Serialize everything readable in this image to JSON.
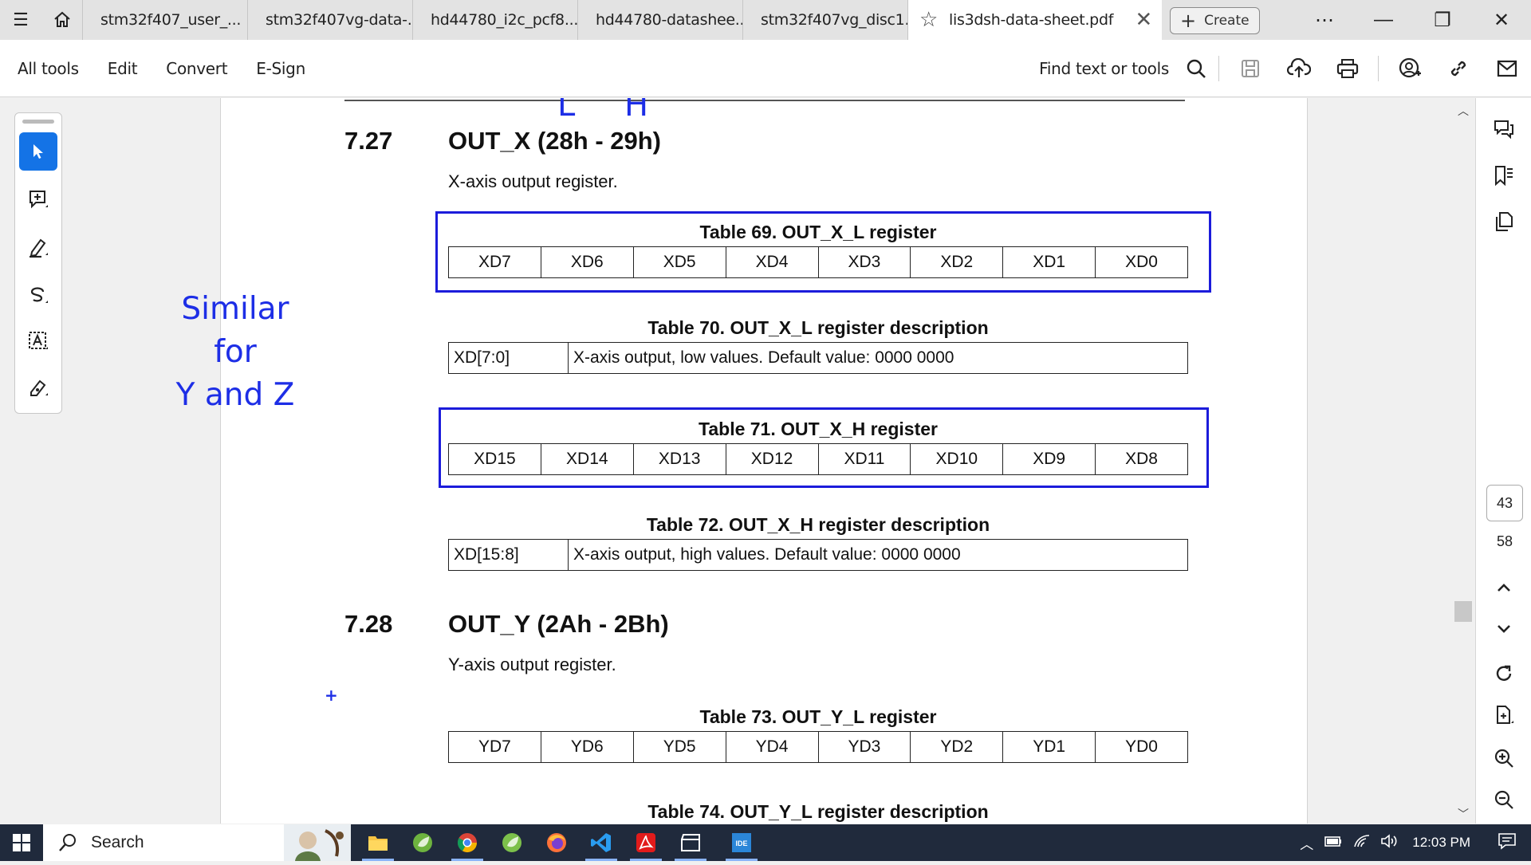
{
  "tabs": [
    {
      "label": "stm32f407_user_..."
    },
    {
      "label": "stm32f407vg-data-..."
    },
    {
      "label": "hd44780_i2c_pcf8..."
    },
    {
      "label": "hd44780-datashee..."
    },
    {
      "label": "stm32f407vg_disc1..."
    }
  ],
  "active_tab": {
    "label": "lis3dsh-data-sheet.pdf"
  },
  "create_label": "Create",
  "menu": {
    "all_tools": "All tools",
    "edit": "Edit",
    "convert": "Convert",
    "esign": "E-Sign"
  },
  "find_label": "Find text or tools",
  "doc": {
    "sec27": {
      "num": "7.27",
      "title": "OUT_X (28h - 29h)",
      "desc": "X-axis output register."
    },
    "t69": {
      "caption": "Table 69. OUT_X_L register",
      "cells": [
        "XD7",
        "XD6",
        "XD5",
        "XD4",
        "XD3",
        "XD2",
        "XD1",
        "XD0"
      ]
    },
    "t70": {
      "caption": "Table 70. OUT_X_L register description",
      "field": "XD[7:0]",
      "text": "X-axis output, low values. Default value: 0000 0000"
    },
    "t71": {
      "caption": "Table 71. OUT_X_H register",
      "cells": [
        "XD15",
        "XD14",
        "XD13",
        "XD12",
        "XD11",
        "XD10",
        "XD9",
        "XD8"
      ]
    },
    "t72": {
      "caption": "Table 72. OUT_X_H register description",
      "field": "XD[15:8]",
      "text": "X-axis output, high values. Default value: 0000 0000"
    },
    "sec28": {
      "num": "7.28",
      "title": "OUT_Y (2Ah - 2Bh)",
      "desc": "Y-axis output register."
    },
    "t73": {
      "caption": "Table 73. OUT_Y_L register",
      "cells": [
        "YD7",
        "YD6",
        "YD5",
        "YD4",
        "YD3",
        "YD2",
        "YD1",
        "YD0"
      ]
    },
    "t74": {
      "caption": "Table 74. OUT_Y_L register description"
    }
  },
  "annotations": {
    "l": "L",
    "h": "H",
    "note_line1": "Similar for",
    "note_line2": "Y and Z"
  },
  "page_nav": {
    "current": "43",
    "total": "58"
  },
  "taskbar": {
    "search": "Search",
    "time": "12:03 PM"
  },
  "colors": {
    "accent": "#1473e6",
    "ink": "#1d2ee6",
    "taskbar": "#202a3c"
  }
}
